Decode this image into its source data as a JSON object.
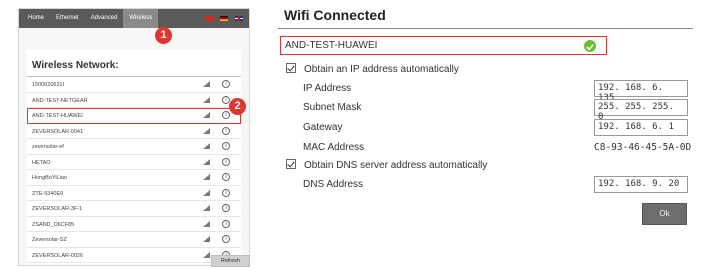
{
  "nav": {
    "items": [
      "Home",
      "Ethernet",
      "Advanced",
      "Wireless"
    ],
    "active": "Wireless"
  },
  "markers": [
    "1",
    "2"
  ],
  "wireless": {
    "title": "Wireless Network:",
    "networks": [
      "1500620631I",
      "AND-TEST-NETGEAR",
      "AND-TEST-HUAWEI",
      "ZEVERSOLAR-0041",
      "zeversolar-ef",
      "HETAO",
      "HongBoYiLiao",
      "ZTE-9340E0",
      "ZEVERSOLAR-3F-1",
      "ZSAND_D6CF85",
      "Zeversolar-SZ",
      "ZEVERSOLAR-0026"
    ],
    "selected_index": 2,
    "info_glyph": "ⓘ",
    "refresh_label": "Refresh"
  },
  "wifi": {
    "title": "Wifi Connected",
    "ssid": "AND-TEST-HUAWEI",
    "status_color": "#6abf2e",
    "obtain_ip_label": "Obtain an IP address automatically",
    "obtain_ip_checked": true,
    "ip_label": "IP Address",
    "ip_value": "192. 168. 6. 135",
    "subnet_label": "Subnet Mask",
    "subnet_value": "255. 255. 255. 0",
    "gateway_label": "Gateway",
    "gateway_value": "192. 168. 6. 1",
    "mac_label": "MAC Address",
    "mac_value": "C8-93-46-45-5A-0D",
    "obtain_dns_label": "Obtain DNS server address automatically",
    "obtain_dns_checked": true,
    "dns_label": "DNS Address",
    "dns_value": "192. 168. 9. 20",
    "ok_label": "Ok"
  },
  "colors": {
    "accent_red": "#e3342f",
    "nav_bg": "#5a5a5a",
    "nav_active_bg": "#8a8a8a"
  }
}
